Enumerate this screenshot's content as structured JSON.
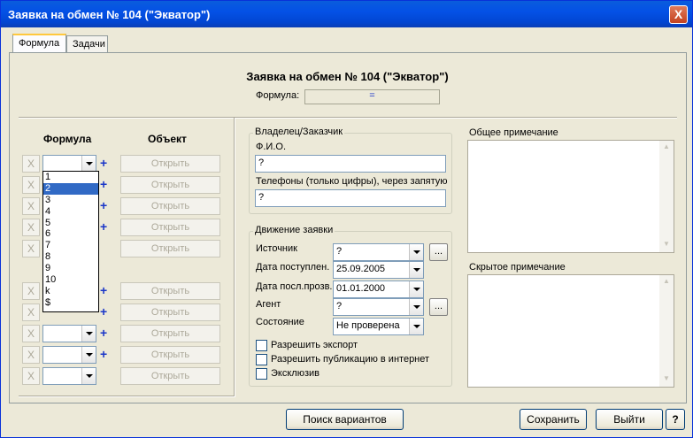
{
  "window": {
    "title": "Заявка на обмен № 104 (\"Экватор\")",
    "close_label": "X"
  },
  "tabs": [
    {
      "label": "Формула"
    },
    {
      "label": "Задачи"
    }
  ],
  "header": {
    "title": "Заявка на обмен № 104 (\"Экватор\")",
    "formula_label": "Формула:",
    "formula_value": "="
  },
  "left": {
    "col_formula": "Формула",
    "col_object": "Объект",
    "x_label": "X",
    "plus_label": "+",
    "open_label": "Открыть",
    "dropdown_options": [
      "1",
      "2",
      "3",
      "4",
      "5",
      "6",
      "7",
      "8",
      "9",
      "10",
      "k",
      "$"
    ],
    "dropdown_selected": "2"
  },
  "owner": {
    "group_title": "Владелец/Заказчик",
    "fio_label": "Ф.И.О.",
    "fio_value": "?",
    "phones_label": "Телефоны (только цифры), через запятую",
    "phones_value": "?"
  },
  "movement": {
    "group_title": "Движение заявки",
    "source_label": "Источник",
    "source_value": "?",
    "date_in_label": "Дата поступлен.",
    "date_in_value": "25.09.2005",
    "date_last_label": "Дата посл.прозв.",
    "date_last_value": "01.01.2000",
    "agent_label": "Агент",
    "agent_value": "?",
    "state_label": "Состояние",
    "state_value": "Не проверена",
    "dots_label": "...",
    "chk_export": "Разрешить экспорт",
    "chk_publish": "Разрешить публикацию в интернет",
    "chk_exclusive": "Эксклюзив"
  },
  "notes": {
    "general_label": "Общее примечание",
    "hidden_label": "Скрытое примечание"
  },
  "footer": {
    "search_label": "Поиск вариантов",
    "save_label": "Сохранить",
    "exit_label": "Выйти",
    "help_label": "?"
  }
}
